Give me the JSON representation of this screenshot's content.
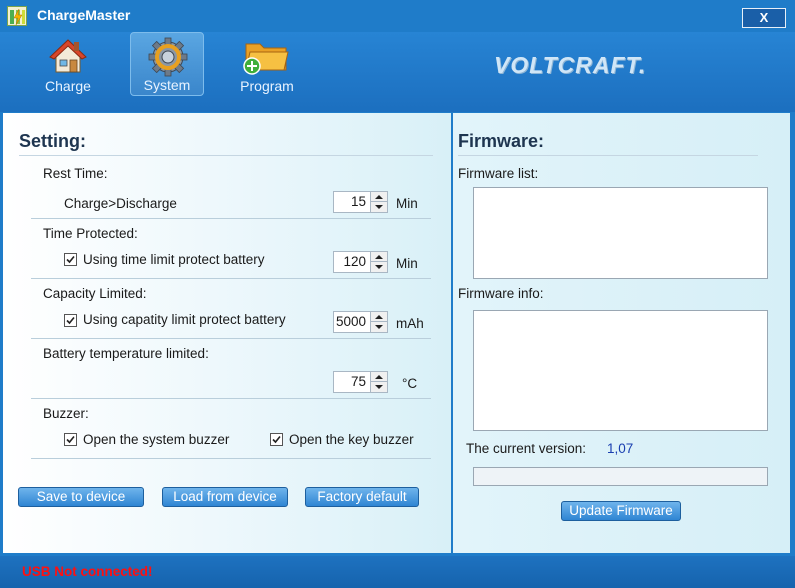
{
  "window": {
    "title": "ChargeMaster",
    "close_label": "X"
  },
  "toolbar": {
    "items": [
      {
        "label": "Charge",
        "icon": "house-icon",
        "selected": false
      },
      {
        "label": "System",
        "icon": "gear-icon",
        "selected": true
      },
      {
        "label": "Program",
        "icon": "folder-add-icon",
        "selected": false
      }
    ],
    "brand": "VOLTCRAFT."
  },
  "settings": {
    "heading": "Setting:",
    "rest_time": {
      "title": "Rest Time:",
      "label": "Charge>Discharge",
      "value": "15",
      "unit": "Min"
    },
    "time_protected": {
      "title": "Time Protected:",
      "checkbox_label": "Using time limit protect battery",
      "checked": true,
      "value": "120",
      "unit": "Min"
    },
    "capacity_limited": {
      "title": "Capacity Limited:",
      "checkbox_label": "Using capatity limit protect battery",
      "checked": true,
      "value": "5000",
      "unit": "mAh"
    },
    "temperature": {
      "title": "Battery temperature limited:",
      "value": "75",
      "unit": "°C"
    },
    "buzzer": {
      "title": "Buzzer:",
      "system_label": "Open the system buzzer",
      "system_checked": true,
      "key_label": "Open the key buzzer",
      "key_checked": true
    },
    "buttons": {
      "save": "Save to device",
      "load": "Load from device",
      "factory": "Factory default"
    }
  },
  "firmware": {
    "heading": "Firmware:",
    "list_label": "Firmware list:",
    "info_label": "Firmware info:",
    "version_label": "The current version:",
    "version_value": "1,07",
    "update_button": "Update Firmware",
    "progress": 0
  },
  "status": {
    "text": "USB  Not connected!"
  },
  "colors": {
    "accent": "#1f7cc9",
    "status_error": "#ff1010",
    "version_value": "#1a3fb0"
  }
}
